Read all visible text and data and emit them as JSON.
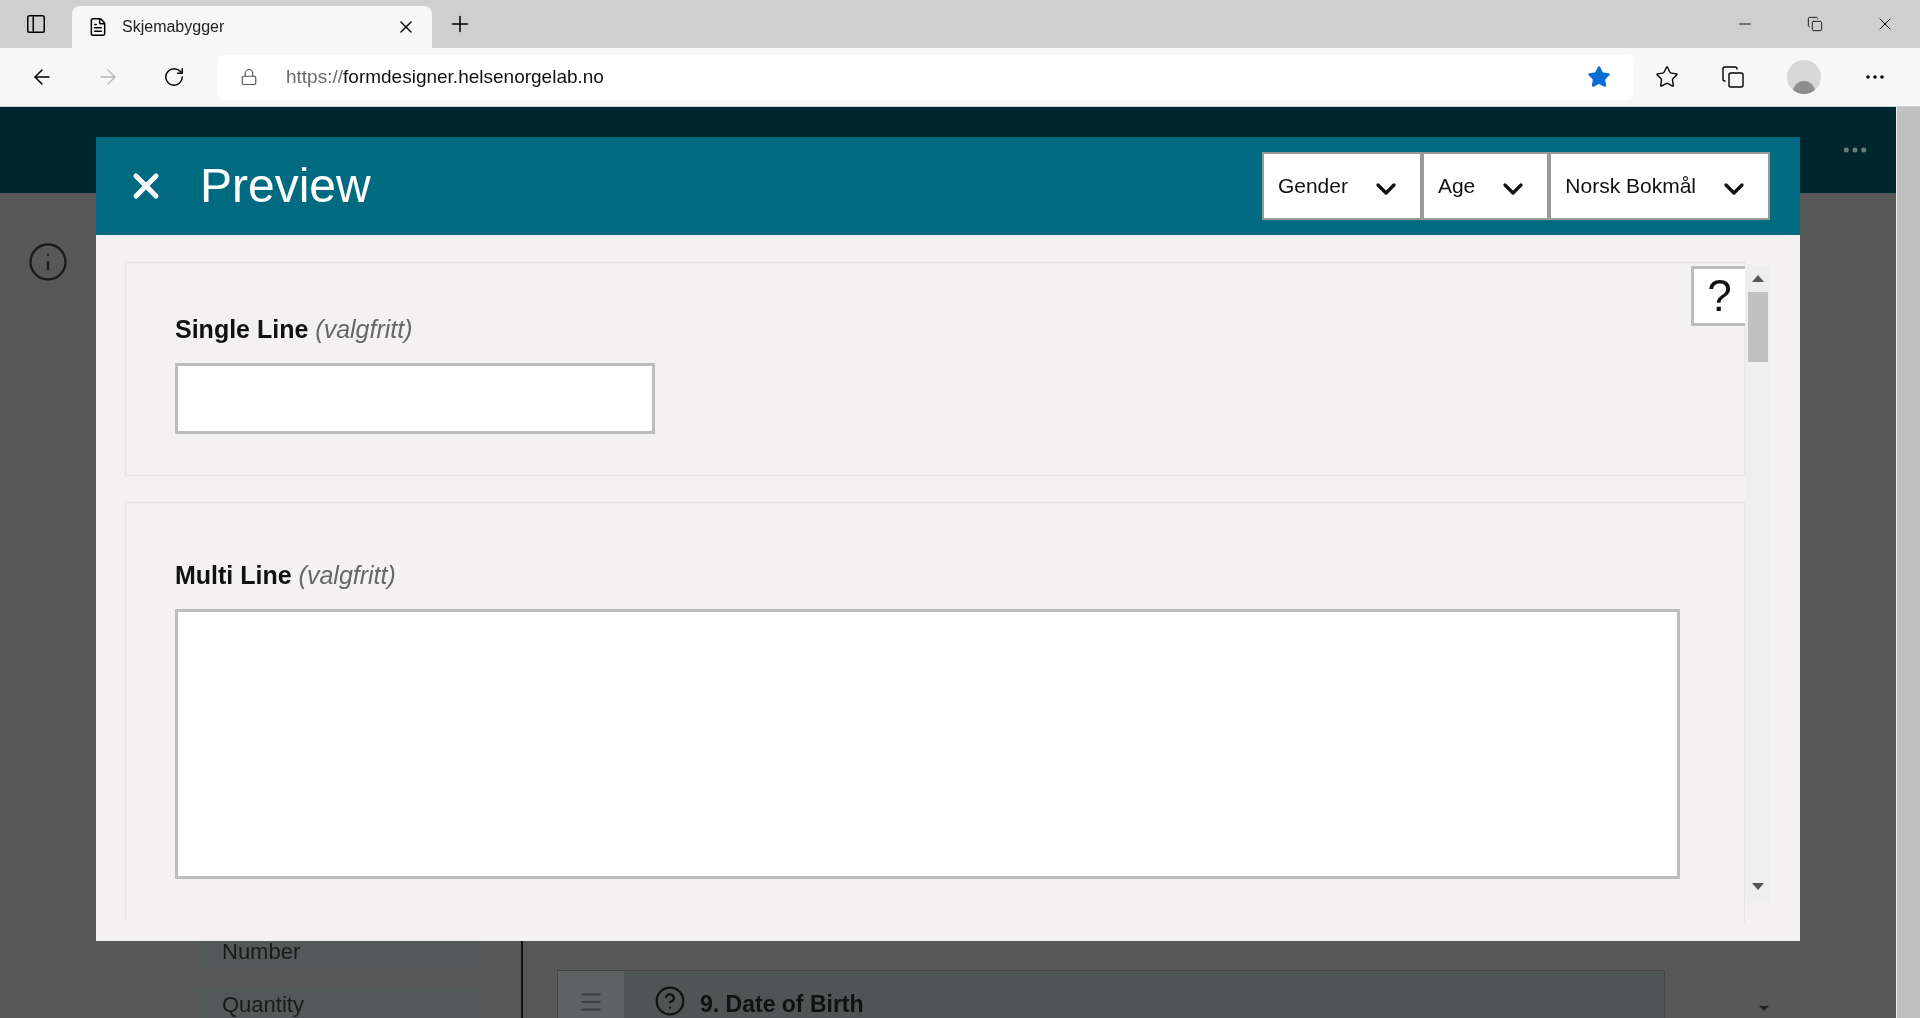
{
  "browser": {
    "tab_title": "Skjemabygger",
    "url_scheme": "https://",
    "url_host": "formdesigner.helsenorgelab.no",
    "bookmarked": true
  },
  "background": {
    "sidebar_items": [
      "Number",
      "Quantity"
    ],
    "question": {
      "title": "9. Date of Birth"
    }
  },
  "modal": {
    "title": "Preview",
    "filters": [
      {
        "label": "Gender"
      },
      {
        "label": "Age"
      },
      {
        "label": "Norsk Bokmål"
      }
    ],
    "help": "?",
    "fields": [
      {
        "kind": "single_line",
        "label": "Single Line",
        "optional": "(valgfritt)"
      },
      {
        "kind": "multi_line",
        "label": "Multi Line",
        "optional": "(valgfritt)"
      }
    ]
  }
}
